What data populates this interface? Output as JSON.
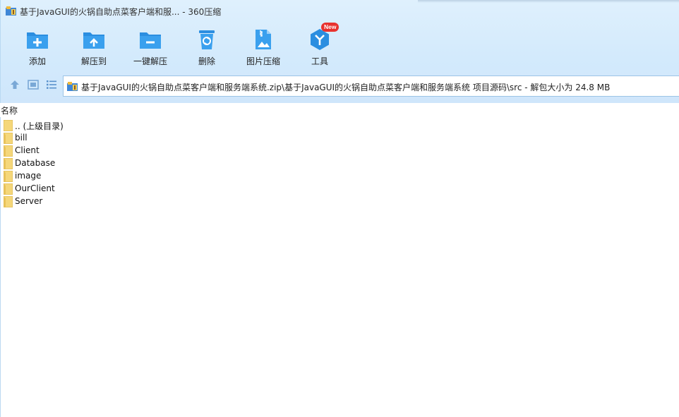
{
  "window": {
    "title": "基于JavaGUI的火锅自助点菜客户端和服... - 360压缩"
  },
  "toolbar": {
    "items": [
      {
        "label": "添加",
        "icon": "add-archive-icon"
      },
      {
        "label": "解压到",
        "icon": "extract-to-icon"
      },
      {
        "label": "一键解压",
        "icon": "one-click-extract-icon"
      },
      {
        "label": "删除",
        "icon": "recycle-bin-icon"
      },
      {
        "label": "图片压缩",
        "icon": "image-compress-icon"
      },
      {
        "label": "工具",
        "icon": "tools-icon",
        "badge": "New"
      }
    ]
  },
  "nav": {
    "up_icon": "arrow-up-icon",
    "thumb_view_icon": "thumbnail-view-icon",
    "list_view_icon": "list-view-icon",
    "address": "基于JavaGUI的火锅自助点菜客户端和服务端系统.zip\\基于JavaGUI的火锅自助点菜客户端和服务端系统 项目源码\\src - 解包大小为 24.8 MB"
  },
  "columns": {
    "name": "名称"
  },
  "files": [
    {
      "name": ".. (上级目录)",
      "type": "parent"
    },
    {
      "name": "bill",
      "type": "folder"
    },
    {
      "name": "Client",
      "type": "folder"
    },
    {
      "name": "Database",
      "type": "folder"
    },
    {
      "name": "image",
      "type": "folder"
    },
    {
      "name": "OurClient",
      "type": "folder"
    },
    {
      "name": "Server",
      "type": "folder"
    }
  ],
  "colors": {
    "accent": "#2b8ee0",
    "header_bg": "#d6ebfc",
    "badge": "#e8322e",
    "folder": "#f5d77a"
  }
}
